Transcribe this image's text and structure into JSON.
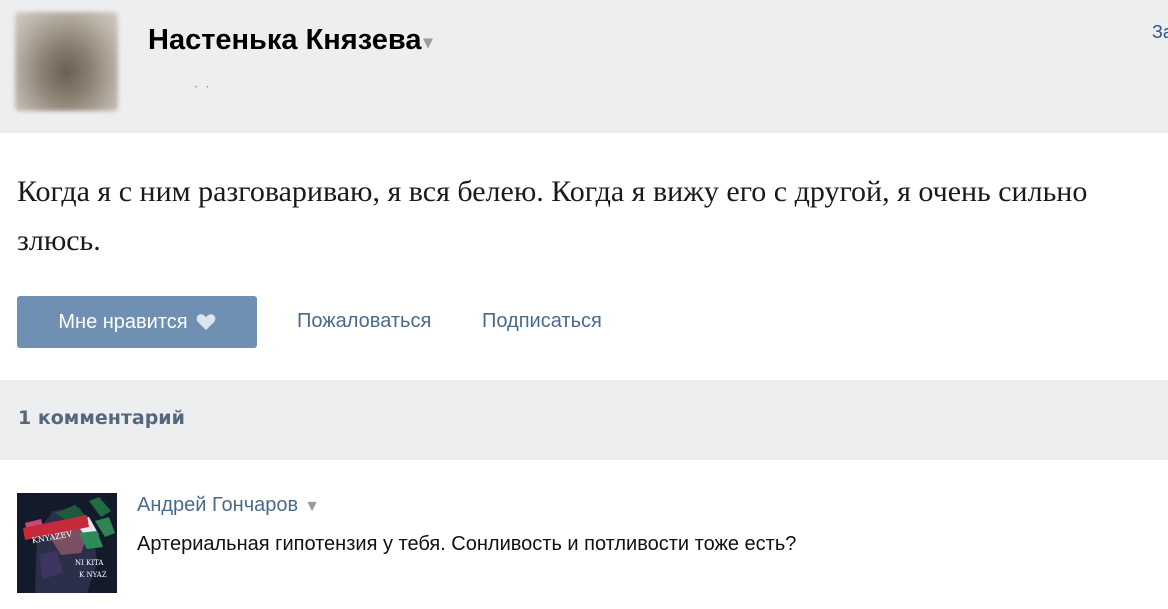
{
  "post": {
    "author": "Настенька Князева",
    "author_menu_glyph": "▾",
    "header_dots": "· ·",
    "header_right_text": "За",
    "text": "Когда я с ним разговариваю, я вся белею. Когда я вижу его с другой, я очень сильно злюсь."
  },
  "actions": {
    "like_label": "Мне нравится",
    "report_label": "Пожаловаться",
    "subscribe_label": "Подписаться"
  },
  "comments": {
    "count_label": "1 комментарий",
    "items": [
      {
        "author": "Андрей Гончаров",
        "menu_glyph": "▼",
        "text": "Артериальная гипотензия у тебя. Сонливость и потливости тоже есть?",
        "avatar_lettering": [
          "KNYAZEV",
          "NI KITA",
          "K NYAZ"
        ]
      }
    ]
  },
  "colors": {
    "header_bg": "#edeef0",
    "like_button_bg": "#6f8fb3",
    "link": "#4a6a8d",
    "comments_count": "#55677d"
  },
  "icons": {
    "like": "heart-icon",
    "author_menu": "chevron-down-icon",
    "comment_menu": "chevron-down-icon"
  }
}
